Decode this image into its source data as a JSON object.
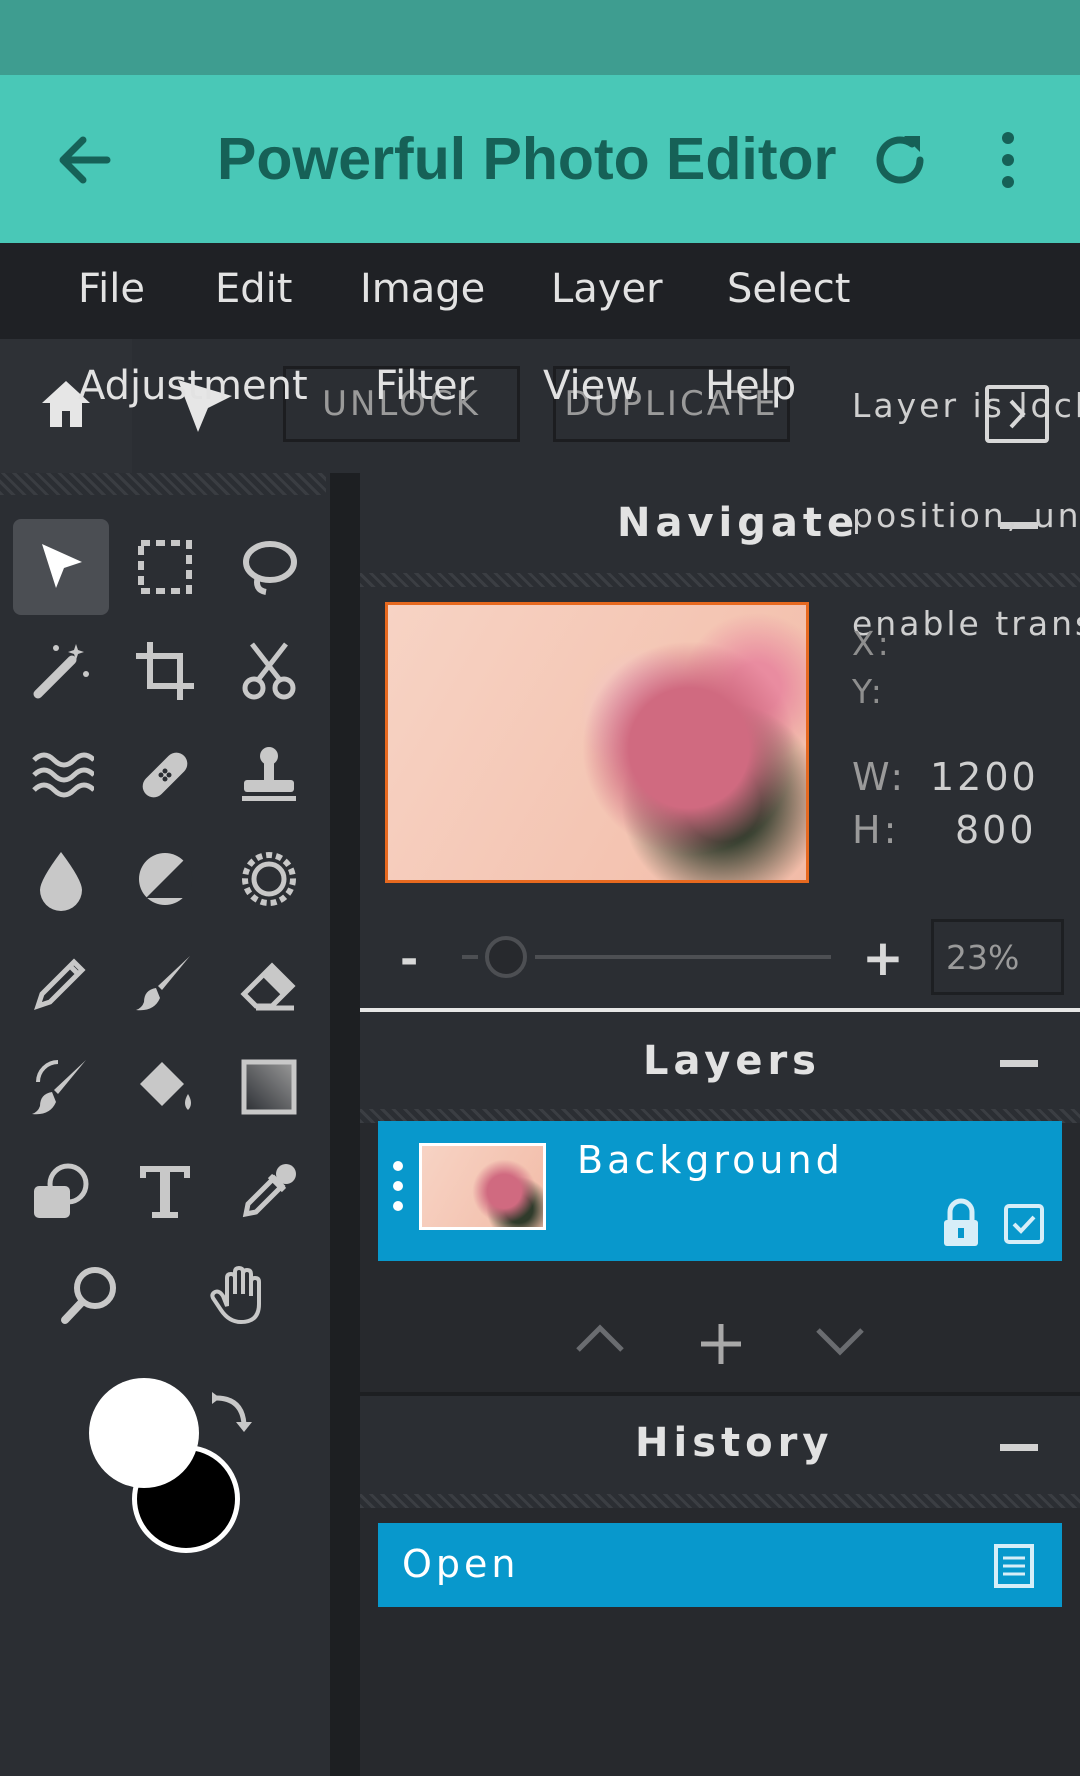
{
  "app_bar": {
    "title": "Powerful Photo Editor",
    "back_icon": "arrow-left-icon",
    "refresh_icon": "refresh-icon",
    "more_icon": "more-vertical-icon"
  },
  "menu": {
    "row1": [
      "File",
      "Edit",
      "Image",
      "Layer",
      "Select"
    ],
    "row2": [
      "Adjustment",
      "Filter",
      "View",
      "Help"
    ]
  },
  "toolbar": {
    "unlock_label": "UNLOCK",
    "duplicate_label": "DUPLICATE",
    "locked_msg_1": "Layer is locke",
    "locked_msg_2": "position, unl",
    "locked_msg_3": "enable trans"
  },
  "navigate": {
    "title": "Navigate",
    "x_label": "X:",
    "y_label": "Y:",
    "w_label": "W:",
    "w_value": "1200",
    "h_label": "H:",
    "h_value": "800",
    "zoom_minus": "-",
    "zoom_plus": "+",
    "zoom_value": "23%"
  },
  "layers": {
    "title": "Layers",
    "items": [
      {
        "name": "Background"
      }
    ]
  },
  "history": {
    "title": "History",
    "items": [
      {
        "label": "Open"
      }
    ]
  },
  "colors": {
    "accent": "#49c8b7",
    "selection": "#0898cc",
    "panel": "#2b2e33",
    "nav_border": "#e7691f"
  }
}
